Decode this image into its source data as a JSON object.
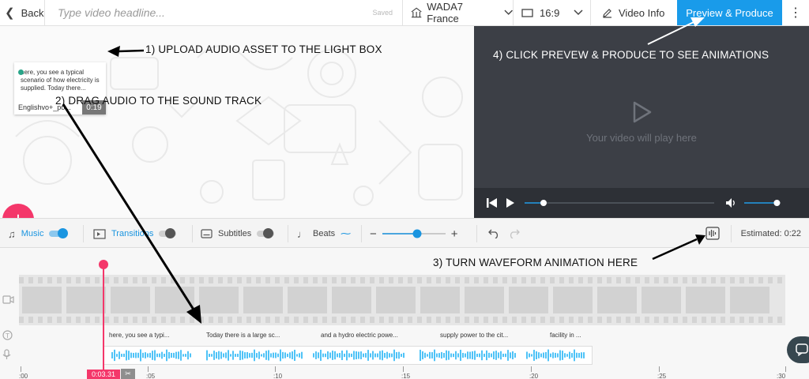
{
  "topbar": {
    "back_label": "Back",
    "headline_placeholder": "Type video headline...",
    "saved_label": "Saved",
    "brand_label": "WADA7 France",
    "ratio_label": "16:9",
    "video_info_label": "Video Info",
    "produce_label": "Preview & Produce"
  },
  "asset": {
    "text": "here, you see a typical scenario of how electricity is supplied. Today there...",
    "filename": "Englishvo+_po...",
    "duration": "0:19"
  },
  "player": {
    "message": "Your video will play here",
    "progress": 0.1,
    "volume": 0.9
  },
  "toolbar": {
    "music_label": "Music",
    "transitions_label": "Transitions",
    "subtitles_label": "Subtitles",
    "beats_label": "Beats",
    "zoom": 0.55,
    "estimated_label": "Estimated: 0:22"
  },
  "timeline": {
    "captions": [
      "here, you see a typi...",
      "Today there is a large sc...",
      "and a hydro electric powe...",
      "supply power to the cit...",
      "facility in ..."
    ],
    "ruler": [
      ":00",
      ":05",
      ":10",
      ":15",
      ":20",
      ":25",
      ":30"
    ],
    "current_time": "0:03.31"
  },
  "annotations": {
    "step1": "1) UPLOAD AUDIO ASSET TO THE LIGHT BOX",
    "step2": "2) DRAG AUDIO TO THE SOUND TRACK",
    "step3": "3) TURN WAVEFORM ANIMATION HERE",
    "step4": "4) CLICK PREVEW & PRODUCE TO SEE ANIMATIONS"
  },
  "colors": {
    "accent": "#199bea",
    "fab": "#f4376a",
    "player_bg": "#3c3f46",
    "waveform": "#4fc3f7"
  }
}
